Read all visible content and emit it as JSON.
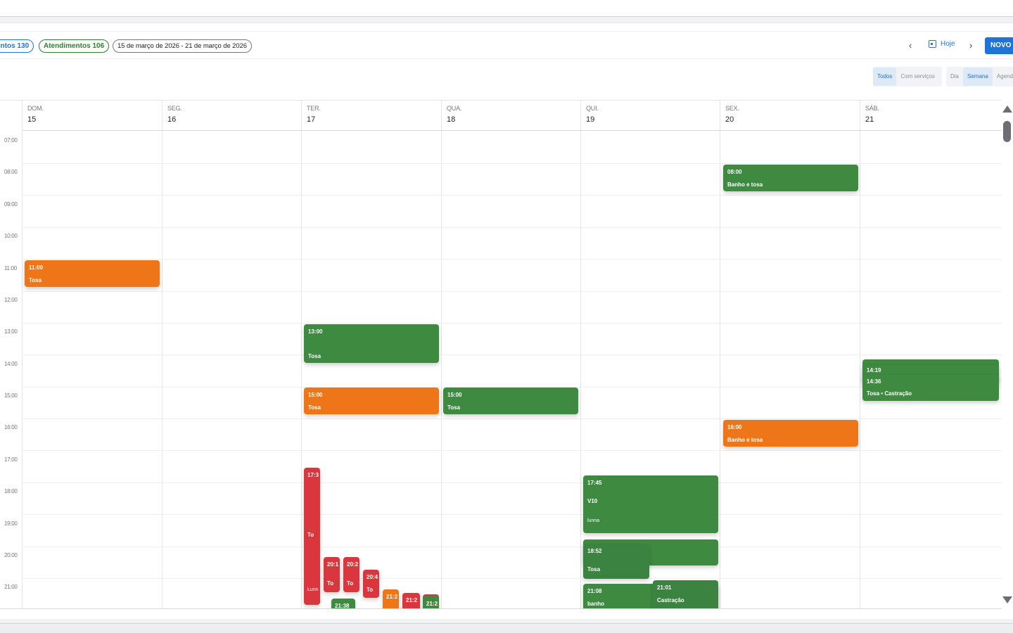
{
  "toolbar": {
    "pill_agendamentos": "entos 130",
    "pill_atendimentos": "Atendimentos 106",
    "date_range": "15 de março de 2026 - 21 de março de 2026",
    "prev": "‹",
    "next": "›",
    "today_label": "Hoje",
    "new_label": "NOVO"
  },
  "filters": {
    "service": [
      "Todos",
      "Com serviços"
    ],
    "service_active": "Todos",
    "view": [
      "Dia",
      "Semana",
      "Agend"
    ],
    "view_active": "Semana"
  },
  "days": [
    {
      "name": "DOM.",
      "num": "15"
    },
    {
      "name": "SEG.",
      "num": "16"
    },
    {
      "name": "TER.",
      "num": "17"
    },
    {
      "name": "QUA.",
      "num": "18"
    },
    {
      "name": "QUI.",
      "num": "19"
    },
    {
      "name": "SEX.",
      "num": "20"
    },
    {
      "name": "SÁB.",
      "num": "21"
    }
  ],
  "hours": [
    "07:00",
    "08:00",
    "09:00",
    "10:00",
    "11:00",
    "12:00",
    "13:00",
    "14:00",
    "15:00",
    "16:00",
    "17:00",
    "18:00",
    "19:00",
    "20:00",
    "21:00"
  ],
  "colors": {
    "green": "#3e8a41",
    "orange": "#ee7618",
    "red": "#d9363e",
    "accent": "#1f74d8"
  },
  "events": [
    {
      "time": "11:00",
      "label": "Tosa"
    },
    {
      "time": "13:00",
      "label": "Tosa"
    },
    {
      "time": "15:00",
      "label": "Tosa"
    },
    {
      "time": "17:3",
      "label": "To",
      "sub": "Lunn"
    },
    {
      "time": "20:1",
      "label": "To"
    },
    {
      "time": "20:2",
      "label": "To"
    },
    {
      "time": "20:4",
      "label": "To"
    },
    {
      "time": "21:2",
      "label": ""
    },
    {
      "time": "21:2",
      "label": ""
    },
    {
      "time": "21:2",
      "label": ""
    },
    {
      "time": "21:38",
      "label": ""
    },
    {
      "time": "15:00",
      "label": "Tosa"
    },
    {
      "time": "17:45",
      "label": "V10",
      "sub": "lunna"
    },
    {
      "time": "",
      "label": ""
    },
    {
      "time": "18:52",
      "label": "Tosa"
    },
    {
      "time": "21:08",
      "label": "banho"
    },
    {
      "time": "21:01",
      "label": "Castração"
    },
    {
      "time": "08:00",
      "label": "Banho e tosa"
    },
    {
      "time": "16:00",
      "label": "Banho e tosa"
    },
    {
      "time": "",
      "label": ""
    },
    {
      "time": "14:19",
      "label": ""
    },
    {
      "time": "14:36",
      "label": "Tosa • Castração"
    }
  ]
}
